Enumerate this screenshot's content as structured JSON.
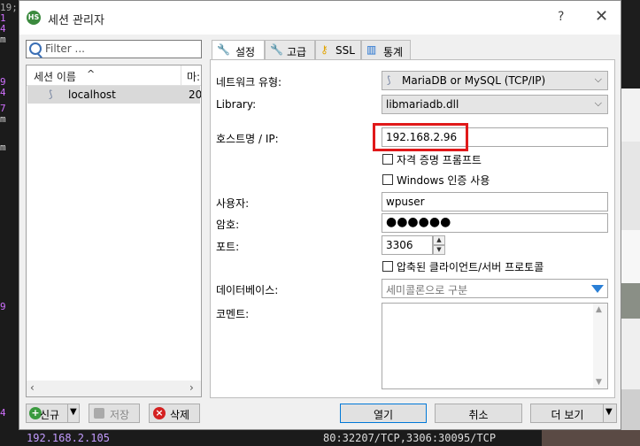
{
  "dialog": {
    "title": "세션 관리자",
    "app_icon_text": "HS",
    "help": "?",
    "close": "✕"
  },
  "left": {
    "filter_placeholder": "Filter ...",
    "column_name": "세션 이름",
    "column_name_sort": "^",
    "column_other": "마:",
    "session": {
      "name": "localhost",
      "col2": "20"
    }
  },
  "tabs": [
    {
      "label": "설정",
      "icon": "wrench-icon"
    },
    {
      "label": "고급",
      "icon": "wrench-icon"
    },
    {
      "label": "SSL",
      "icon": "key-icon"
    },
    {
      "label": "통계",
      "icon": "bar-chart-icon"
    }
  ],
  "settings": {
    "network_type_label": "네트워크 유형:",
    "network_type_value": "MariaDB or MySQL (TCP/IP)",
    "library_label": "Library:",
    "library_value": "libmariadb.dll",
    "host_label": "호스트명 / IP:",
    "host_value": "192.168.2.96",
    "prompt_credentials": "자격 증명 프롬프트",
    "windows_auth": "Windows 인증 사용",
    "user_label": "사용자:",
    "user_value": "wpuser",
    "password_label": "암호:",
    "password_value": "●●●●●●",
    "port_label": "포트:",
    "port_value": "3306",
    "compressed": "압축된 클라이언트/서버 프로토콜",
    "databases_label": "데이터베이스:",
    "databases_placeholder": "세미콜론으로 구분",
    "comment_label": "코멘트:"
  },
  "buttons": {
    "new": "신규",
    "save": "저장",
    "delete": "삭제",
    "open": "열기",
    "cancel": "취소",
    "more": "더 보기"
  },
  "terminal": {
    "bottom_left": "192.168.2.105",
    "bottom_right": "80:32207/TCP,3306:30095/TCP",
    "top_fragment": "19;"
  },
  "colors": {
    "highlight": "#e0191a",
    "accent": "#0078d7",
    "terminal_ip": "#d7a8ff"
  }
}
